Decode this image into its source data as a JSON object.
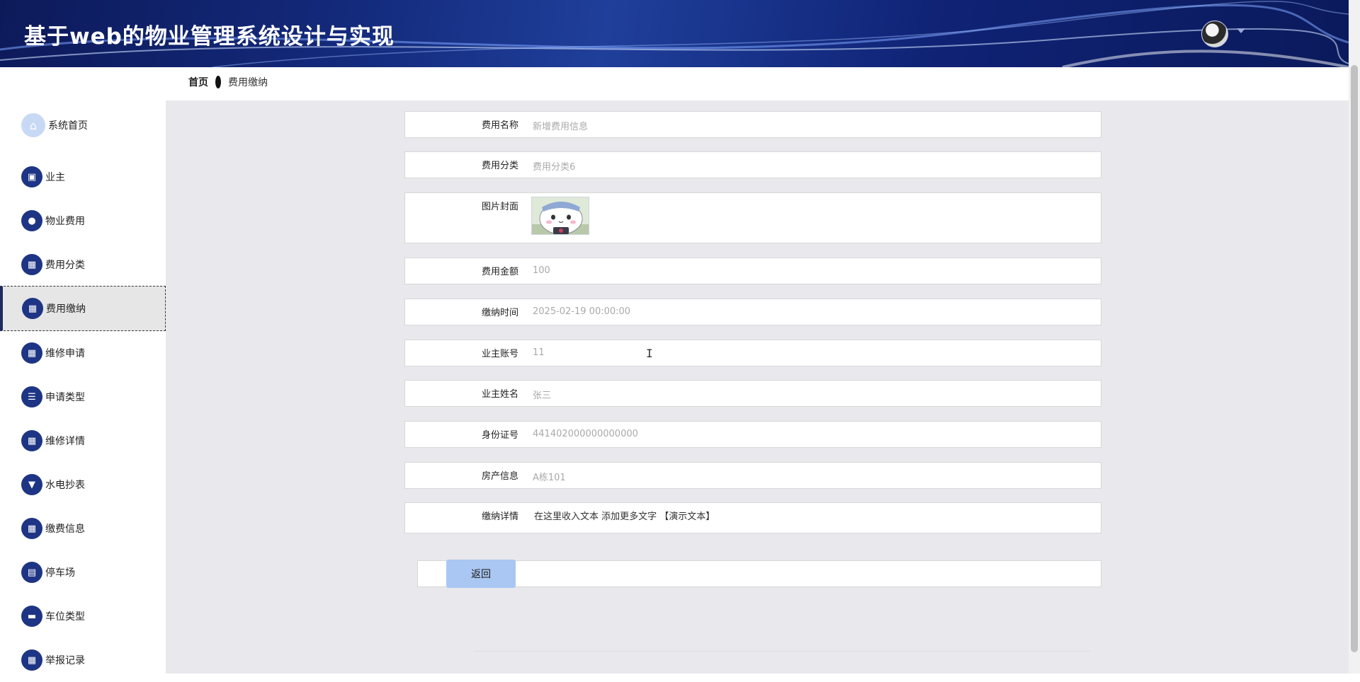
{
  "header": {
    "title": "基于web的物业管理系统设计与实现"
  },
  "breadcrumb": {
    "home": "首页",
    "current": "费用缴纳"
  },
  "sidebar": {
    "items": [
      {
        "label": "系统首页",
        "icon": "home-icon",
        "glyph": "⌂"
      },
      {
        "label": "业主",
        "icon": "briefcase-icon",
        "glyph": "▣"
      },
      {
        "label": "物业费用",
        "icon": "location-pin-icon",
        "glyph": "●"
      },
      {
        "label": "费用分类",
        "icon": "grid-icon",
        "glyph": "▦"
      },
      {
        "label": "费用缴纳",
        "icon": "grid-icon",
        "glyph": "▦"
      },
      {
        "label": "维修申请",
        "icon": "grid-icon",
        "glyph": "▦"
      },
      {
        "label": "申请类型",
        "icon": "list-icon",
        "glyph": "☰"
      },
      {
        "label": "维修详情",
        "icon": "grid-icon",
        "glyph": "▦"
      },
      {
        "label": "水电抄表",
        "icon": "brush-icon",
        "glyph": "▼"
      },
      {
        "label": "缴费信息",
        "icon": "grid-icon",
        "glyph": "▦"
      },
      {
        "label": "停车场",
        "icon": "chart-icon",
        "glyph": "▤"
      },
      {
        "label": "车位类型",
        "icon": "chat-icon",
        "glyph": "▬"
      },
      {
        "label": "举报记录",
        "icon": "grid-icon",
        "glyph": "▦"
      }
    ],
    "active_index": 4
  },
  "form": {
    "fee_name": {
      "label": "费用名称",
      "value": "新增费用信息"
    },
    "fee_category": {
      "label": "费用分类",
      "value": "费用分类6"
    },
    "cover_image": {
      "label": "图片封面"
    },
    "fee_amount": {
      "label": "费用金额",
      "value": "100"
    },
    "pay_time": {
      "label": "缴纳时间",
      "value": "2025-02-19 00:00:00"
    },
    "owner_account": {
      "label": "业主账号",
      "value": "11"
    },
    "owner_name": {
      "label": "业主姓名",
      "value": "张三"
    },
    "id_number": {
      "label": "身份证号",
      "value": "441402000000000000"
    },
    "property_info": {
      "label": "房产信息",
      "value": "A栋101"
    },
    "pay_details": {
      "label": "缴纳详情",
      "value": "在这里收入文本 添加更多文字 【演示文本】"
    }
  },
  "buttons": {
    "back": "返回"
  },
  "colors": {
    "header_bg": "#13297a",
    "sidebar_icon": "#1e3585",
    "button_bg": "#a9c7f2",
    "main_bg": "#e9e8ec"
  }
}
